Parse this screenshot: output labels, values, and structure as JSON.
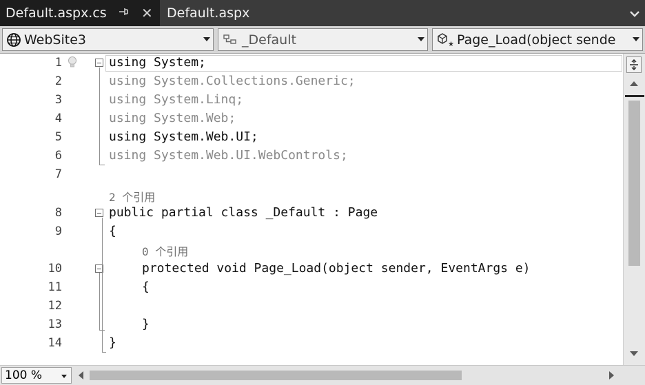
{
  "tabs": [
    {
      "label": "Default.aspx.cs",
      "active": true
    },
    {
      "label": "Default.aspx",
      "active": false
    }
  ],
  "tab_icons": {
    "pin": "⊣",
    "close": "✕"
  },
  "nav": {
    "project": "WebSite3",
    "class": "_Default",
    "member": "Page_Load(object sende"
  },
  "editor": {
    "lines": [
      {
        "num": "1",
        "text": "using System;"
      },
      {
        "num": "2",
        "text": "using System.Collections.Generic;"
      },
      {
        "num": "3",
        "text": "using System.Linq;"
      },
      {
        "num": "4",
        "text": "using System.Web;"
      },
      {
        "num": "5",
        "text": "using System.Web.UI;"
      },
      {
        "num": "6",
        "text": "using System.Web.UI.WebControls;"
      },
      {
        "num": "7",
        "text": ""
      },
      {
        "num": "8",
        "text": "public partial class _Default : Page"
      },
      {
        "num": "9",
        "text": "{"
      },
      {
        "num": "10",
        "text": "protected void Page_Load(object sender, EventArgs e)"
      },
      {
        "num": "11",
        "text": "{"
      },
      {
        "num": "12",
        "text": ""
      },
      {
        "num": "13",
        "text": "}"
      },
      {
        "num": "14",
        "text": "}"
      }
    ],
    "codelens": [
      "2 个引用",
      "0 个引用"
    ]
  },
  "statusbar": {
    "zoom": "100 %"
  },
  "colors": {
    "tab_bar": "#3b3b3b",
    "active_tab": "#1d1d1d",
    "nav_bar": "#d6d6d6",
    "dim_text": "#8a8a8a"
  }
}
